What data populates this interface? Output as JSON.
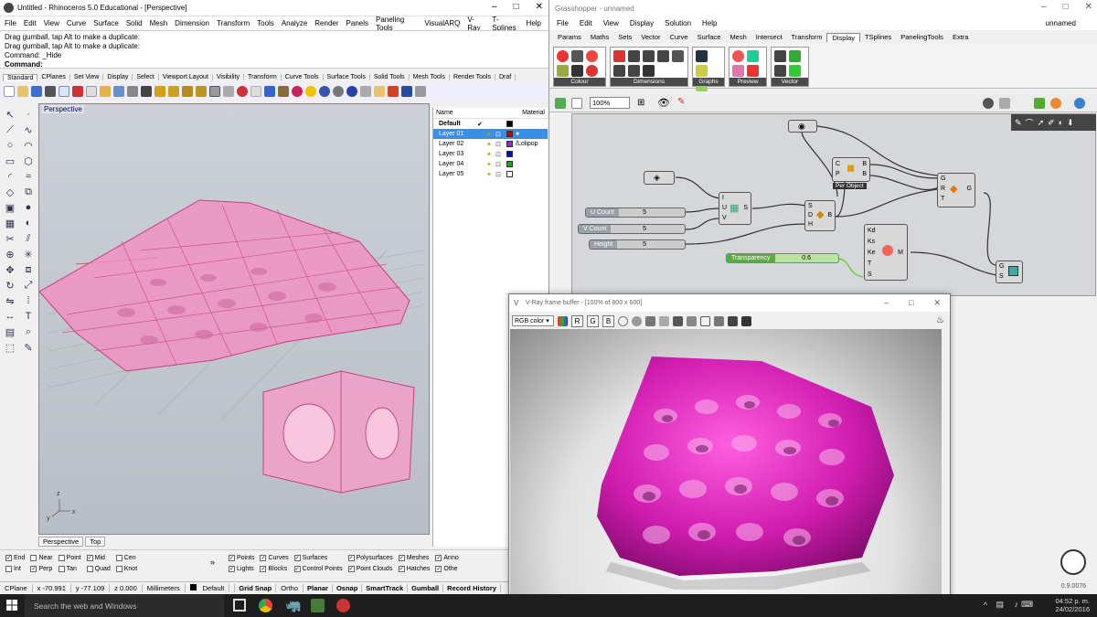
{
  "rhino": {
    "title": "Untitled - Rhinoceros 5.0 Educational - [Perspective]",
    "menu": [
      "File",
      "Edit",
      "View",
      "Curve",
      "Surface",
      "Solid",
      "Mesh",
      "Dimension",
      "Transform",
      "Tools",
      "Analyze",
      "Render",
      "Panels",
      "Paneling Tools",
      "VisualARQ",
      "V-Ray",
      "T-Splines",
      "Help"
    ],
    "cmd_lines": [
      "Drag gumball, tap Alt to make a duplicate:",
      "Drag gumball, tap Alt to make a duplicate:",
      "Command: _Hide"
    ],
    "cmd_label": "Command:",
    "tabs": [
      "Standard",
      "CPlanes",
      "Set View",
      "Display",
      "Select",
      "Viewport Layout",
      "Visibility",
      "Transform",
      "Curve Tools",
      "Surface Tools",
      "Solid Tools",
      "Mesh Tools",
      "Render Tools",
      "Draf"
    ],
    "viewport_label": "Perspective",
    "viewport_tabs": [
      "Perspective",
      "Top"
    ],
    "axis": {
      "x": "x",
      "y": "y",
      "z": "z"
    },
    "layers_header": {
      "name": "Name",
      "material": "Material"
    },
    "layers": [
      {
        "name": "Default",
        "check": "✔",
        "color": "#000000",
        "bold": true
      },
      {
        "name": "Layer 01",
        "color": "#cc0000",
        "selected": true
      },
      {
        "name": "Layer 02",
        "color": "#8a2be2",
        "material": "/Lolipop"
      },
      {
        "name": "Layer 03",
        "color": "#0000ee"
      },
      {
        "name": "Layer 04",
        "color": "#11aa11"
      },
      {
        "name": "Layer 05",
        "color": "#ffffff"
      }
    ],
    "osnaps": [
      {
        "label": "End",
        "checked": true
      },
      {
        "label": "Int",
        "checked": false
      },
      {
        "label": "Near",
        "checked": false
      },
      {
        "label": "Perp",
        "checked": true
      },
      {
        "label": "Point",
        "checked": false
      },
      {
        "label": "Tan",
        "checked": false
      },
      {
        "label": "Mid",
        "checked": true
      },
      {
        "label": "Quad",
        "checked": false
      },
      {
        "label": "Cen",
        "checked": false
      },
      {
        "label": "Knot",
        "checked": false
      }
    ],
    "osnap_more": "»",
    "filters": [
      {
        "label": "Points",
        "checked": true
      },
      {
        "label": "Lights",
        "checked": true
      },
      {
        "label": "Curves",
        "checked": true
      },
      {
        "label": "Blocks",
        "checked": true
      },
      {
        "label": "Surfaces",
        "checked": true
      },
      {
        "label": "Control Points",
        "checked": true
      },
      {
        "label": "Polysurfaces",
        "checked": true
      },
      {
        "label": "Point Clouds",
        "checked": true
      },
      {
        "label": "Meshes",
        "checked": true
      },
      {
        "label": "Hatches",
        "checked": true
      },
      {
        "label": "Anno",
        "checked": true
      },
      {
        "label": "Othe",
        "checked": true
      }
    ],
    "status": {
      "cplane": "CPlane",
      "x": "x -70.991",
      "y": "y -77.109",
      "z": "z 0.000",
      "units": "Millimeters",
      "layer": "Default",
      "toggles": [
        "Grid Snap",
        "Ortho",
        "Planar",
        "Osnap",
        "SmartTrack",
        "Gumball",
        "Record History"
      ]
    }
  },
  "gh": {
    "title": "Grasshopper - unnamed",
    "menu": [
      "File",
      "Edit",
      "View",
      "Display",
      "Solution",
      "Help"
    ],
    "doc": "unnamed",
    "tabs": [
      "Params",
      "Maths",
      "Sets",
      "Vector",
      "Curve",
      "Surface",
      "Mesh",
      "Intersect",
      "Transform",
      "Display",
      "TSplines",
      "PanelingTools",
      "Extra"
    ],
    "active_tab": "Display",
    "groups": [
      "Colour",
      "Dimensions",
      "Graphs",
      "Preview",
      "Vector"
    ],
    "zoom": "100%",
    "sliders": [
      {
        "name": "U Count",
        "value": "5"
      },
      {
        "name": "V Count",
        "value": "5"
      },
      {
        "name": "Height",
        "value": "5"
      },
      {
        "name": "Transparency",
        "value": "0.6"
      }
    ],
    "per_object": "Per Object",
    "ports": {
      "box": {
        "in": [
          "I",
          "U",
          "V"
        ],
        "out": "S"
      },
      "morph": {
        "in": [
          "S",
          "D",
          "H"
        ],
        "out": "B"
      },
      "colour": {
        "in": [
          "C",
          "P"
        ],
        "out": [
          "B",
          "B"
        ]
      },
      "material": {
        "in": [
          "Kd",
          "Ks",
          "Ke",
          "T",
          "S"
        ],
        "out": "M"
      },
      "preview": {
        "in": [
          "G",
          "R",
          "T"
        ],
        "out": "G"
      },
      "custom": {
        "in": [
          "G",
          "S"
        ]
      }
    },
    "status_value": "0.9.0076"
  },
  "vray": {
    "title": "V-Ray frame buffer - [100% of 800 x 600]",
    "channel": "RGB color",
    "channels": [
      "R",
      "G",
      "B"
    ]
  },
  "taskbar": {
    "search": "Search the web and Windows",
    "time": "04:52 p. m.",
    "date": "24/02/2016"
  }
}
